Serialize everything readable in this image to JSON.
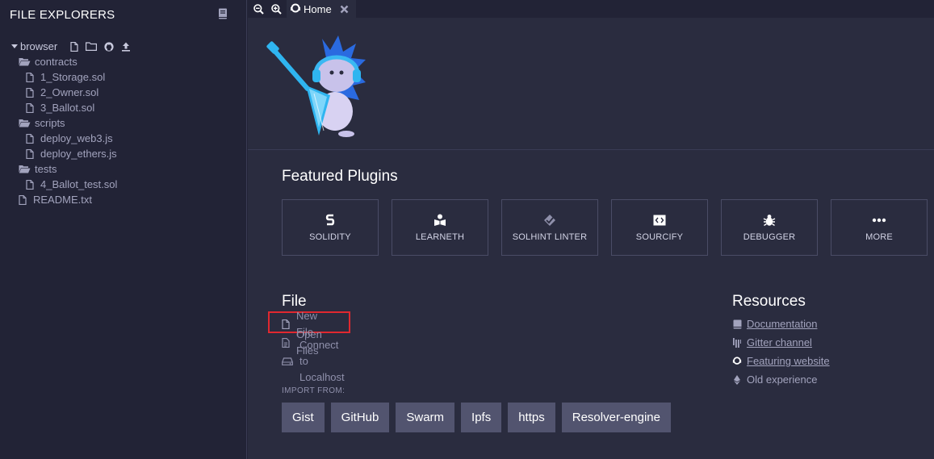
{
  "sidebar": {
    "title": "FILE EXPLORERS",
    "root": {
      "label": "browser",
      "tools": [
        "new-file-icon",
        "new-folder-icon",
        "github-icon",
        "upload-icon"
      ]
    },
    "tree": [
      {
        "label": "contracts",
        "type": "folder",
        "depth": 1
      },
      {
        "label": "1_Storage.sol",
        "type": "file",
        "depth": 2
      },
      {
        "label": "2_Owner.sol",
        "type": "file",
        "depth": 2
      },
      {
        "label": "3_Ballot.sol",
        "type": "file",
        "depth": 2
      },
      {
        "label": "scripts",
        "type": "folder",
        "depth": 1
      },
      {
        "label": "deploy_web3.js",
        "type": "file",
        "depth": 2
      },
      {
        "label": "deploy_ethers.js",
        "type": "file",
        "depth": 2
      },
      {
        "label": "tests",
        "type": "folder",
        "depth": 1
      },
      {
        "label": "4_Ballot_test.sol",
        "type": "file",
        "depth": 2
      },
      {
        "label": "README.txt",
        "type": "file",
        "depth": 1
      }
    ]
  },
  "tabs": {
    "home": {
      "label": "Home"
    }
  },
  "featured": {
    "title": "Featured Plugins",
    "plugins": [
      {
        "label": "SOLIDITY",
        "icon": "solidity-icon"
      },
      {
        "label": "LEARNETH",
        "icon": "learneth-icon"
      },
      {
        "label": "SOLHINT LINTER",
        "icon": "solhint-icon"
      },
      {
        "label": "SOURCIFY",
        "icon": "sourcify-icon"
      },
      {
        "label": "DEBUGGER",
        "icon": "debugger-icon"
      },
      {
        "label": "MORE",
        "icon": "more-icon"
      }
    ]
  },
  "file": {
    "title": "File",
    "new_file": "New File",
    "open_files": "Open Files",
    "connect_localhost": "Connect to Localhost",
    "import_label": "IMPORT FROM:",
    "import_buttons": [
      "Gist",
      "GitHub",
      "Swarm",
      "Ipfs",
      "https",
      "Resolver-engine"
    ]
  },
  "resources": {
    "title": "Resources",
    "documentation": "Documentation",
    "gitter": "Gitter channel",
    "featuring": "Featuring website",
    "old_experience": "Old experience"
  },
  "colors": {
    "background": "#222336",
    "panel": "#2a2c3f",
    "button": "#52546f",
    "highlight": "#e0282f",
    "accent": "#2fb5f0"
  }
}
